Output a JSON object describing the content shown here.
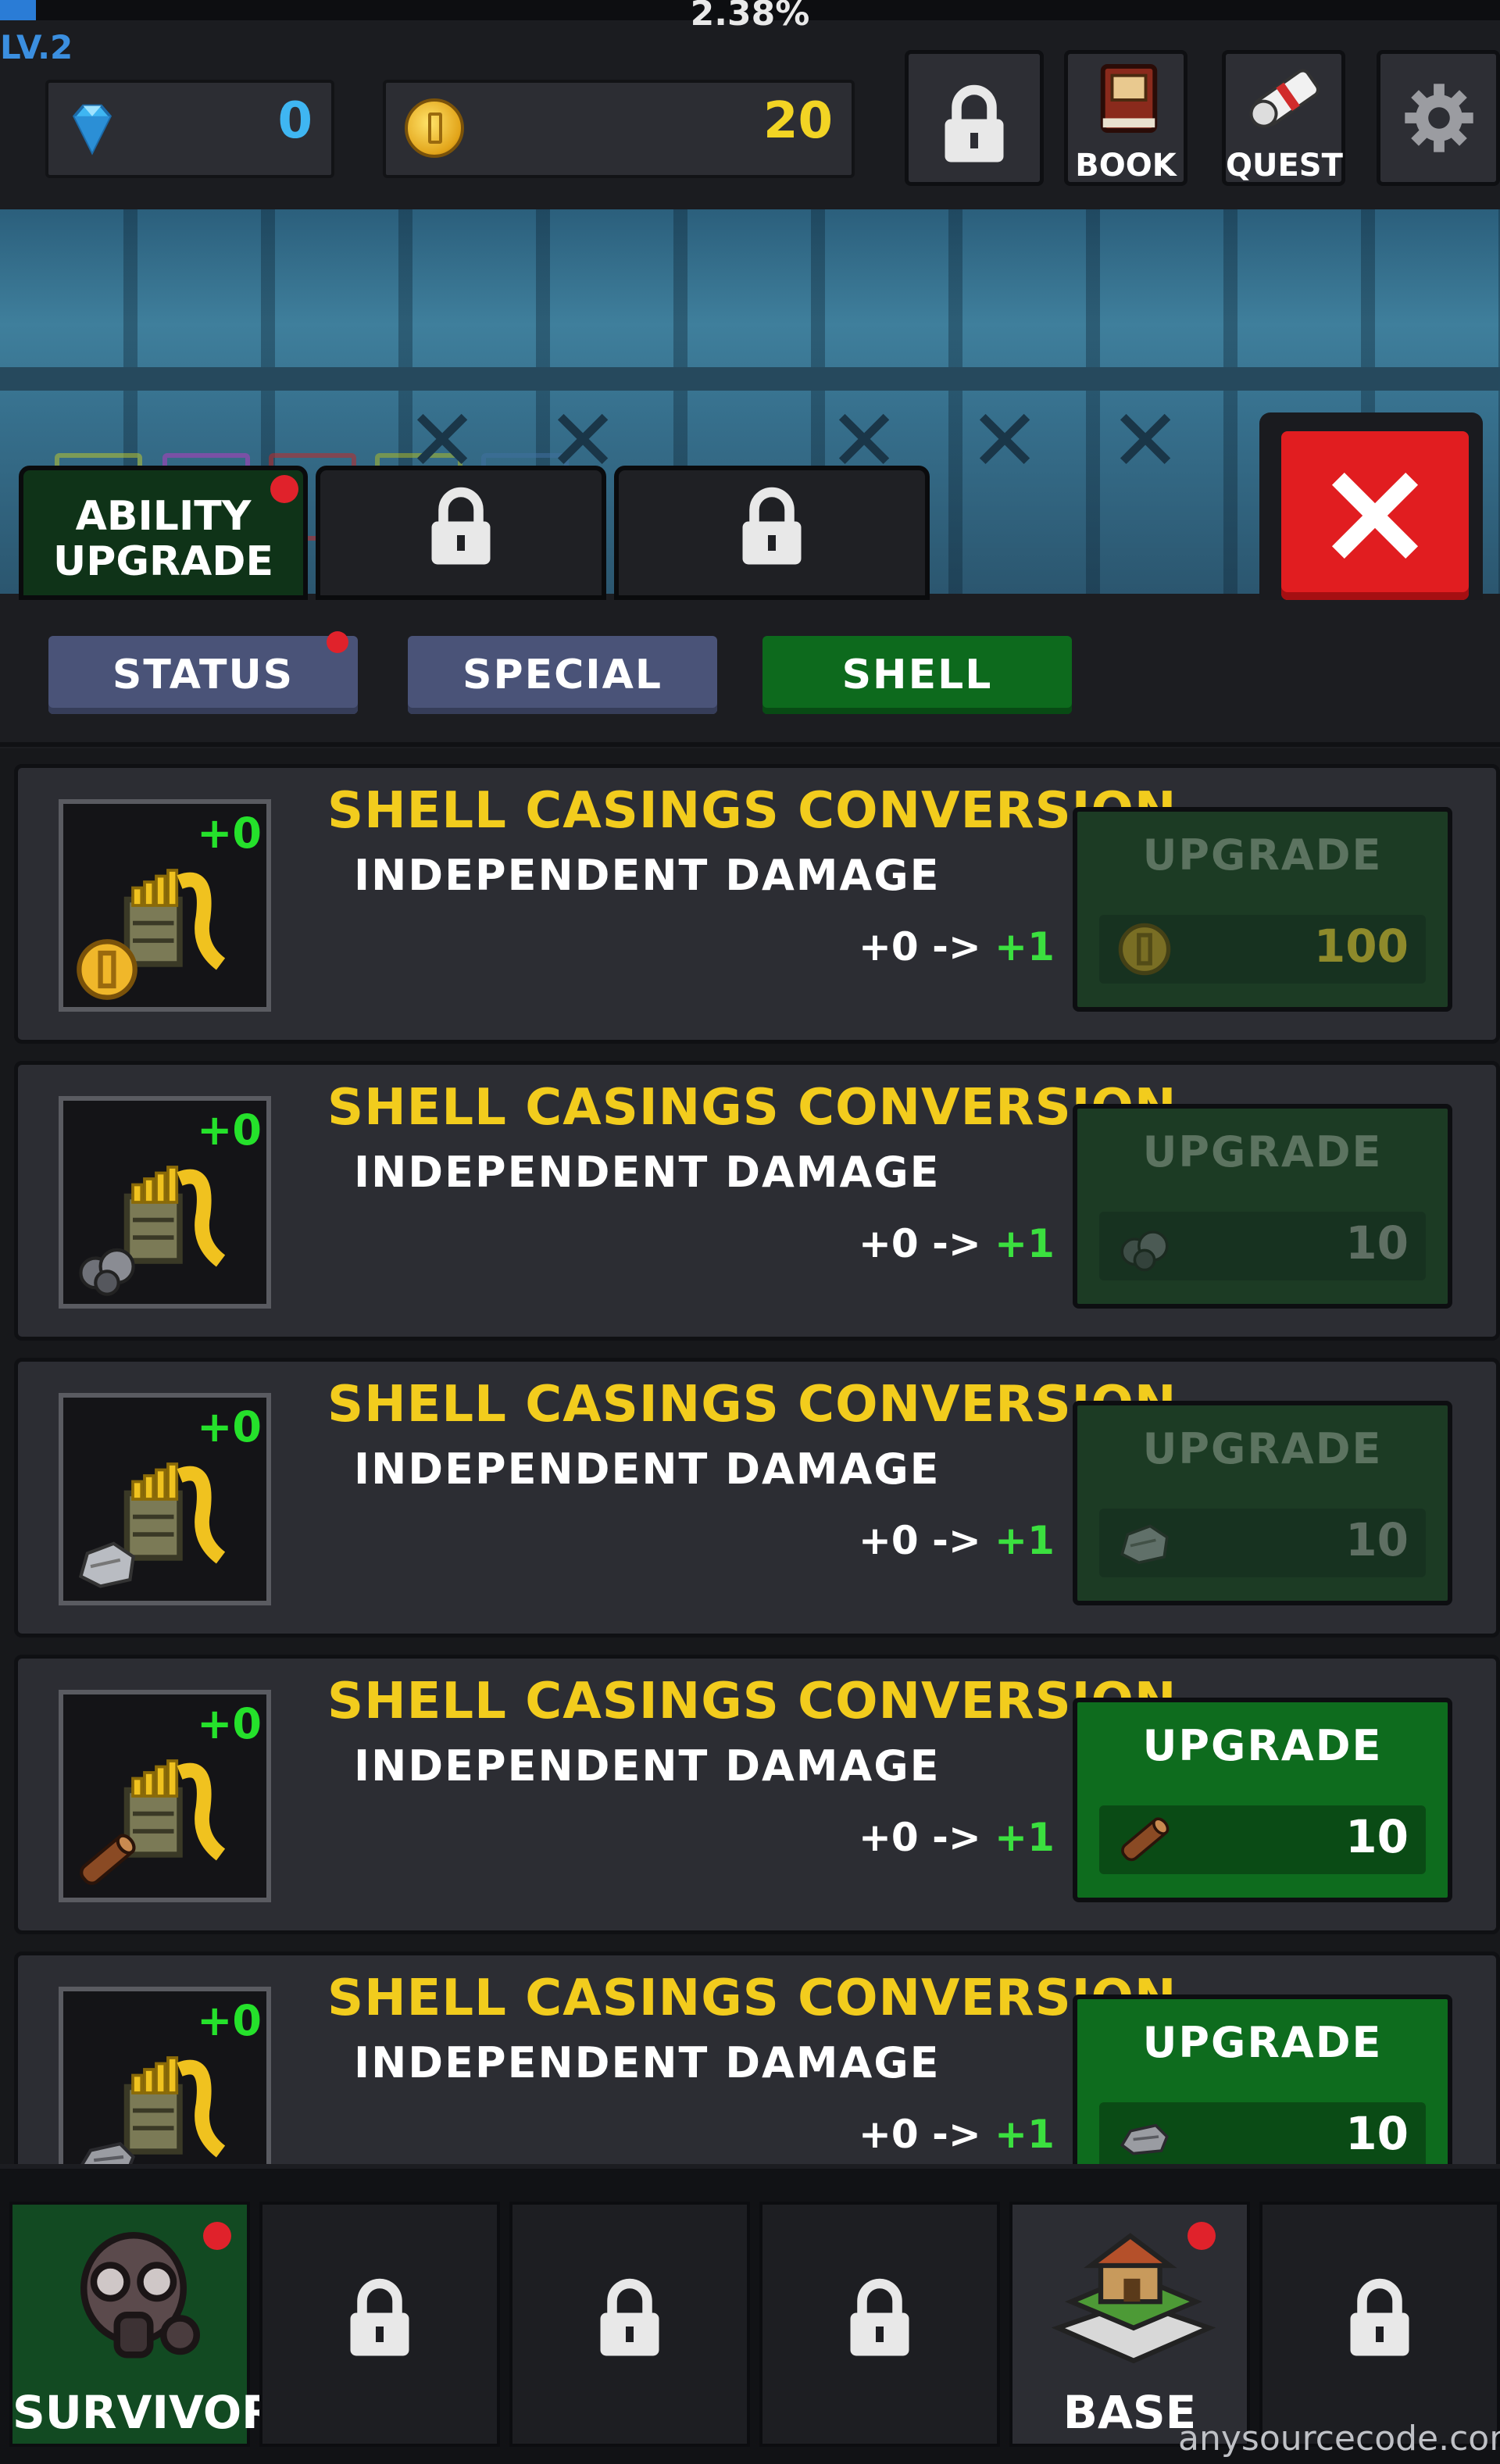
{
  "header": {
    "progress_text": "2.38%",
    "progress_fraction": 0.0238,
    "level": "LV.2",
    "gems": "0",
    "coins": "20",
    "book_label": "BOOK",
    "quest_label": "QUEST"
  },
  "tabs": {
    "ability_upgrade": "ABILITY UPGRADE"
  },
  "subtabs": {
    "status": "STATUS",
    "special": "SPECIAL",
    "shell": "SHELL",
    "active": "SHELL"
  },
  "upgrades": [
    {
      "title": "SHELL CASINGS CONVERSION",
      "desc": "INDEPENDENT DAMAGE",
      "level_badge": "+0",
      "from": "+0 ->",
      "to": "+1",
      "button": "UPGRADE",
      "cost": "100",
      "material": "coin-icon",
      "enabled": false
    },
    {
      "title": "SHELL CASINGS CONVERSION",
      "desc": "INDEPENDENT DAMAGE",
      "level_badge": "+0",
      "from": "+0 ->",
      "to": "+1",
      "button": "UPGRADE",
      "cost": "10",
      "material": "ore-icon",
      "enabled": false
    },
    {
      "title": "SHELL CASINGS CONVERSION",
      "desc": "INDEPENDENT DAMAGE",
      "level_badge": "+0",
      "from": "+0 ->",
      "to": "+1",
      "button": "UPGRADE",
      "cost": "10",
      "material": "stone-icon",
      "enabled": false
    },
    {
      "title": "SHELL CASINGS CONVERSION",
      "desc": "INDEPENDENT DAMAGE",
      "level_badge": "+0",
      "from": "+0 ->",
      "to": "+1",
      "button": "UPGRADE",
      "cost": "10",
      "material": "wood-icon",
      "enabled": true
    },
    {
      "title": "SHELL CASINGS CONVERSION",
      "desc": "INDEPENDENT DAMAGE",
      "level_badge": "+0",
      "from": "+0 ->",
      "to": "+1",
      "button": "UPGRADE",
      "cost": "10",
      "material": "scrap-icon",
      "enabled": true
    }
  ],
  "bottom_nav": {
    "survivor": "SURVIVOR",
    "base": "BASE"
  },
  "watermark": "anysourcecode.com",
  "colors": {
    "accent_green": "#0e6c1e",
    "title_yellow": "#f2cc1d",
    "plus_green": "#25e12b",
    "close_red": "#e11d20",
    "tab_blue": "#4a5378"
  }
}
